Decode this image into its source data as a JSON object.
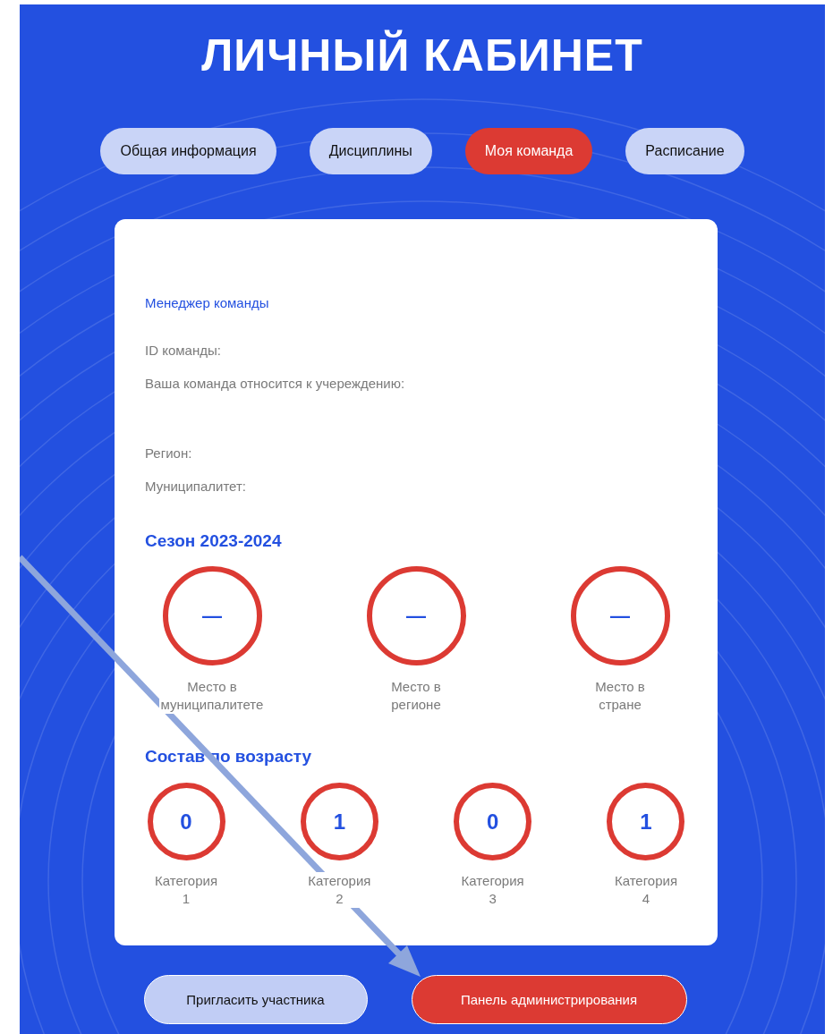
{
  "title": "ЛИЧНЫЙ КАБИНЕТ",
  "tabs": [
    {
      "label": "Общая информация",
      "selected": false
    },
    {
      "label": "Дисциплины",
      "selected": false
    },
    {
      "label": "Моя команда",
      "selected": true
    },
    {
      "label": "Расписание",
      "selected": false
    }
  ],
  "team_card": {
    "manager_link": "Менеджер команды",
    "fields": [
      "ID команды:",
      "Ваша команда относится к учереждению:",
      "Регион:",
      "Муниципалитет:"
    ],
    "season": {
      "heading": "Сезон 2023-2024",
      "ratings": [
        {
          "value": "—",
          "label": "Место в\nмуниципалитете"
        },
        {
          "value": "—",
          "label": "Место в\nрегионе"
        },
        {
          "value": "—",
          "label": "Место в\nстране"
        }
      ]
    },
    "age": {
      "heading": "Состав по возрасту",
      "categories": [
        {
          "value": "0",
          "label": "Категория\n1"
        },
        {
          "value": "1",
          "label": "Категория\n2"
        },
        {
          "value": "0",
          "label": "Категория\n3"
        },
        {
          "value": "1",
          "label": "Категория\n4"
        }
      ]
    }
  },
  "buttons": [
    {
      "label": "Пригласить участника",
      "kind": "secondary"
    },
    {
      "label": "Панель администрирования",
      "kind": "primary"
    }
  ]
}
